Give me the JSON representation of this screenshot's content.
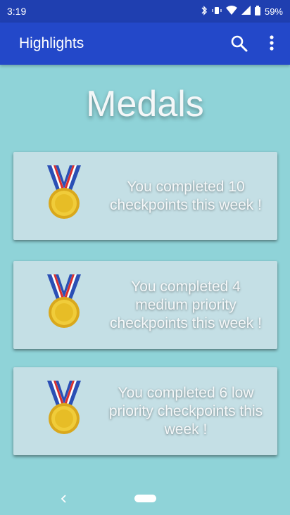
{
  "status_bar": {
    "time": "3:19",
    "battery": "59%",
    "icons": [
      "bluetooth-icon",
      "vibrate-icon",
      "wifi-icon",
      "signal-icon",
      "battery-icon"
    ]
  },
  "app_bar": {
    "title": "Highlights",
    "actions": [
      "search-icon",
      "more-vert-icon"
    ]
  },
  "page": {
    "title": "Medals"
  },
  "cards": [
    {
      "icon": "gold-medal-icon",
      "text": "You completed 10 checkpoints this week !"
    },
    {
      "icon": "gold-medal-icon",
      "text": "You completed 4 medium priority checkpoints this week !"
    },
    {
      "icon": "gold-medal-icon",
      "text": "You completed 6 low priority checkpoints this week !"
    }
  ],
  "colors": {
    "status_bar": "#1f3fb0",
    "app_bar": "#2348c9",
    "background": "#8fd3d8",
    "card": "#c4dfe5",
    "medal_gold": "#e8c12a",
    "ribbon_red": "#d8312f",
    "ribbon_blue": "#2a4fb5"
  }
}
